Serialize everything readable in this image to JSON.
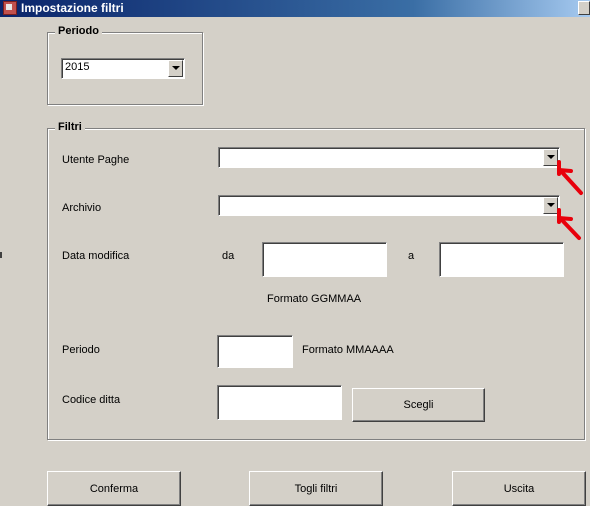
{
  "window": {
    "title": "Impostazione filtri"
  },
  "periodo_group": {
    "legend": "Periodo",
    "year_value": "2015"
  },
  "filtri_group": {
    "legend": "Filtri",
    "utente_paghe_label": "Utente Paghe",
    "utente_paghe_value": "",
    "archivio_label": "Archivio",
    "archivio_value": "",
    "data_modifica_label": "Data modifica",
    "da_label": "da",
    "a_label": "a",
    "data_format_hint": "Formato GGMMAA",
    "periodo_label": "Periodo",
    "periodo_format_hint": "Formato MMAAAA",
    "codice_ditta_label": "Codice ditta",
    "scegli_label": "Scegli"
  },
  "buttons": {
    "conferma": "Conferma",
    "togli_filtri": "Togli filtri",
    "uscita": "Uscita"
  },
  "colors": {
    "annotation_arrow": "#e8000b",
    "titlebar": "#0a246a",
    "face": "#d4d0c8"
  }
}
